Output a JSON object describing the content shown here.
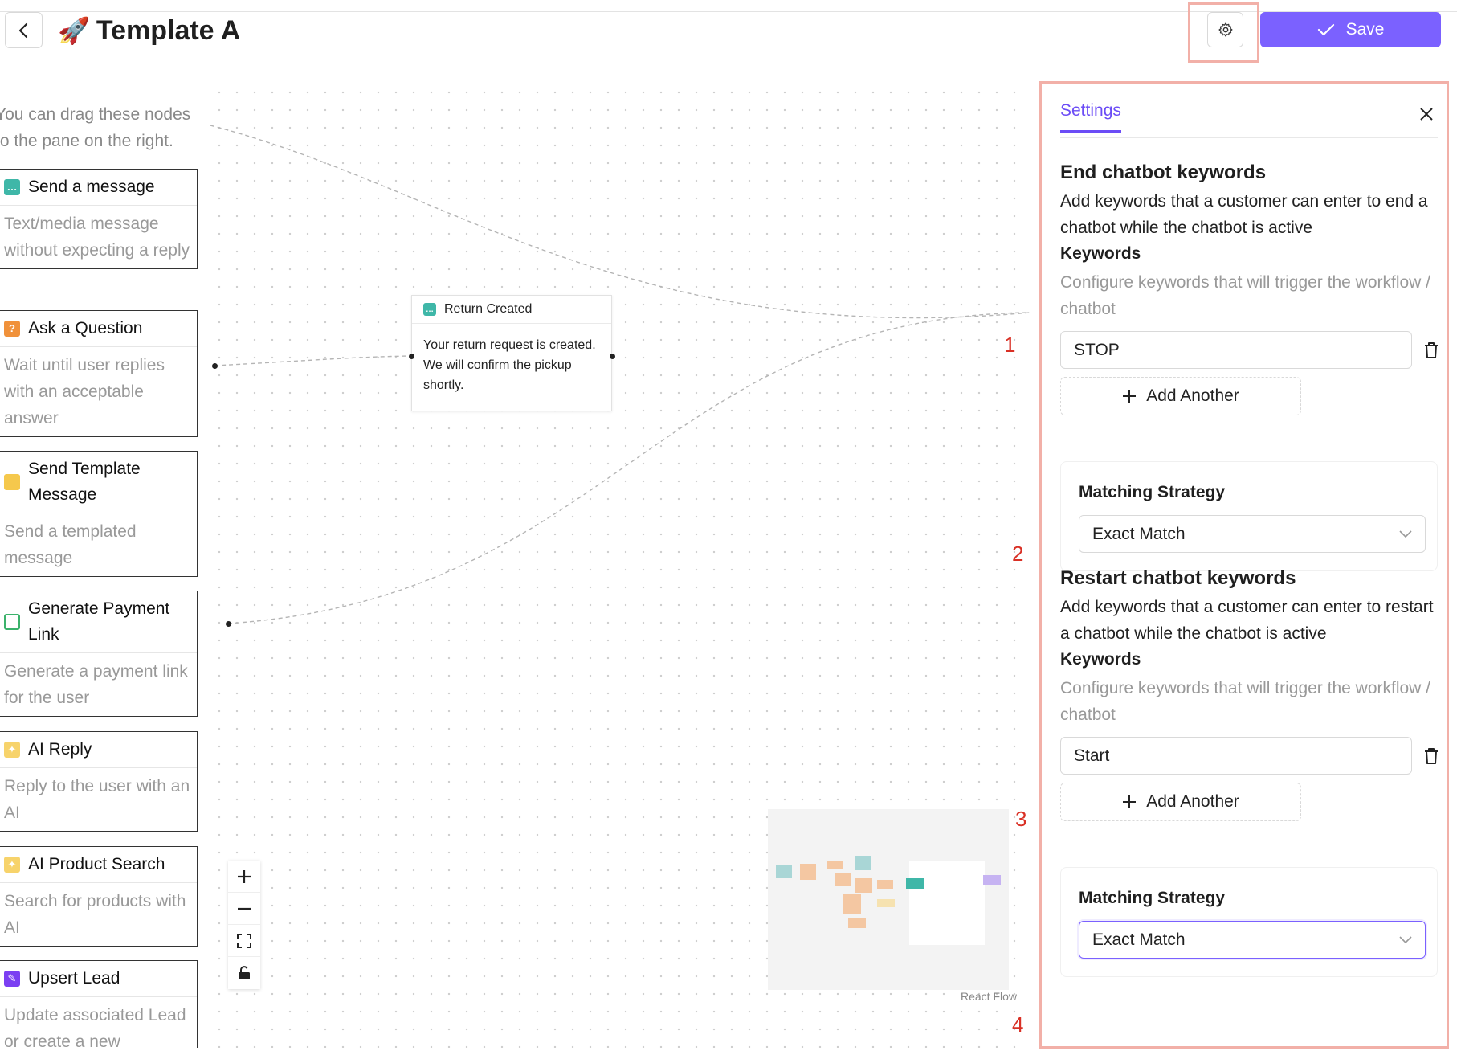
{
  "header": {
    "title_emoji": "🚀",
    "title": "Template A",
    "save_label": "Save"
  },
  "palette": {
    "hint": "You can drag these nodes to the pane on the right.",
    "nodes": [
      {
        "label": "Send a message",
        "desc": "Text/media message without expecting a reply",
        "icon": "chat-icon"
      },
      {
        "label": "Ask a Question",
        "desc": "Wait until user replies with an acceptable answer",
        "icon": "question-icon"
      },
      {
        "label": "Send Template Message",
        "desc": "Send a templated message",
        "icon": "template-icon"
      },
      {
        "label": "Generate Payment Link",
        "desc": "Generate a payment link for the user",
        "icon": "card-icon"
      },
      {
        "label": "AI Reply",
        "desc": "Reply to the user with an AI",
        "icon": "magic-wand-icon"
      },
      {
        "label": "AI Product Search",
        "desc": "Search for products with AI",
        "icon": "magic-wand-icon"
      },
      {
        "label": "Upsert Lead",
        "desc": "Update associated Lead or create a new",
        "icon": "edit-icon"
      }
    ]
  },
  "canvas": {
    "node": {
      "title": "Return Created",
      "body": "Your return request is created. We will confirm the pickup shortly."
    },
    "minimap_label": "React Flow",
    "step_numbers": [
      "1",
      "2",
      "3",
      "4"
    ]
  },
  "settings": {
    "tab": "Settings",
    "end": {
      "title": "End chatbot keywords",
      "text": "Add keywords that a customer can enter to end a chatbot while the chatbot is active",
      "keywords_label": "Keywords",
      "keywords_help": "Configure keywords that will trigger the workflow / chatbot",
      "keyword_value": "STOP",
      "add_label": "Add Another",
      "matching_label": "Matching Strategy",
      "matching_value": "Exact Match"
    },
    "restart": {
      "title": "Restart chatbot keywords",
      "text": "Add keywords that a customer can enter to restart a chatbot while the chatbot is active",
      "keywords_label": "Keywords",
      "keywords_help": "Configure keywords that will trigger the workflow / chatbot",
      "keyword_value": "Start",
      "add_label": "Add Another",
      "matching_label": "Matching Strategy",
      "matching_value": "Exact Match"
    }
  },
  "colors": {
    "accent": "#7b61ff",
    "highlight_box": "#f2b0a8",
    "step_number": "#d93025"
  }
}
